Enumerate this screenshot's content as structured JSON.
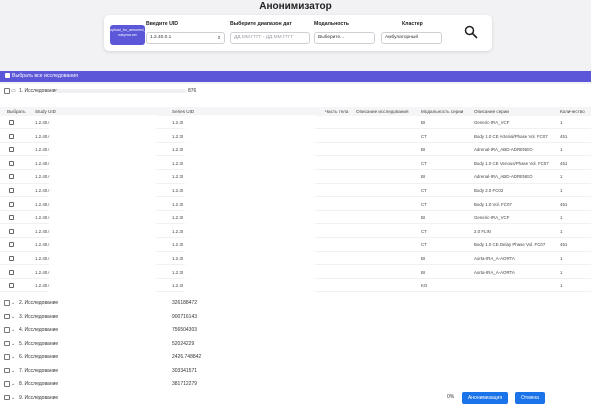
{
  "page_title": "Анонимизатор",
  "toolbar": {
    "upload_label": "upload_for_annonimi_z nakyma.cer",
    "uid_label": "Введите UID",
    "uid_value": "1.2.40.0.1",
    "date_label": "Выберите диапазон дат",
    "date_placeholder": "ДД.ММ.ГГГГ - ДД.ММ.ГГГГ",
    "modality_label": "Модальность",
    "modality_value": "Выберите...",
    "cluster_label": "Кластер",
    "cluster_value": "Амбулаторный"
  },
  "select_all_label": "Выбрать все исследования",
  "expanded_study": {
    "label": "1. Исследование",
    "number": "876"
  },
  "table_headers": {
    "select": "Выбрать",
    "study_uid": "Study UID",
    "series_uid": "Series UID",
    "body_part": "Часть тела",
    "study_desc": "Описание исследования",
    "modality": "Модальность серии",
    "series_desc": "Описание серии",
    "count": "Количество"
  },
  "series_rows": [
    {
      "study_uid": "1.2.40.0",
      "series_uid": "1.2.3t",
      "modality": "BI",
      "desc": "Generic-IRA_VCF",
      "count": "1"
    },
    {
      "study_uid": "1.2.40.0",
      "series_uid": "1.2.3t",
      "modality": "CT",
      "desc": "Body 1.0 CE Arterial/Phase Vol. FC07",
      "count": "451"
    },
    {
      "study_uid": "1.2.40.0",
      "series_uid": "1.2.3t",
      "modality": "BI",
      "desc": "Adrenal-IRA_ABD-ADRENEO",
      "count": "1"
    },
    {
      "study_uid": "1.2.40.0",
      "series_uid": "1.2.3t",
      "modality": "CT",
      "desc": "Body 1.0 CE Venous/Phase Vol. FC07",
      "count": "451"
    },
    {
      "study_uid": "1.2.40.0",
      "series_uid": "1.2.3t",
      "modality": "BI",
      "desc": "Adrenal-IRA_ABD-ADRENEO",
      "count": "1"
    },
    {
      "study_uid": "1.2.40.0",
      "series_uid": "1.2.3t",
      "modality": "CT",
      "desc": "Body 2.0 FC02",
      "count": "1"
    },
    {
      "study_uid": "1.2.40.0",
      "series_uid": "1.2.3t",
      "modality": "CT",
      "desc": "Body 1.0 Vol. FC07",
      "count": "451"
    },
    {
      "study_uid": "1.2.40.0",
      "series_uid": "1.2.3t",
      "modality": "BI",
      "desc": "Generic-IRA_VCF",
      "count": "1"
    },
    {
      "study_uid": "1.2.40.0",
      "series_uid": "1.2.3t",
      "modality": "CT",
      "desc": "2.0 FLIN",
      "count": "1"
    },
    {
      "study_uid": "1.2.40.0",
      "series_uid": "1.2.3t",
      "modality": "CT",
      "desc": "Body 1.0 CE Delay Phase Vol. FC07",
      "count": "451"
    },
    {
      "study_uid": "1.2.40.0",
      "series_uid": "1.2.3t",
      "modality": "BI",
      "desc": "Aorta-IRA_A-AORTA",
      "count": "1"
    },
    {
      "study_uid": "1.2.40.0",
      "series_uid": "1.2.3t",
      "modality": "BI",
      "desc": "Aorta-IRA_A-AORTA",
      "count": "1"
    },
    {
      "study_uid": "1.2.40.0",
      "series_uid": "1.2.4t",
      "modality": "KO",
      "desc": "",
      "count": "1"
    }
  ],
  "studies": [
    {
      "label": "2. Исследование",
      "number": "326188472"
    },
    {
      "label": "3. Исследование",
      "number": "900716143"
    },
    {
      "label": "4. Исследование",
      "number": "756504303"
    },
    {
      "label": "5. Исследование",
      "number": "52024229"
    },
    {
      "label": "6. Исследование",
      "number": "2426.748842"
    },
    {
      "label": "7. Исследование",
      "number": "303341571"
    },
    {
      "label": "8. Исследование",
      "number": "381712279"
    },
    {
      "label": "9. Исследование",
      "number": ""
    }
  ],
  "footer": {
    "progress": "0%",
    "anonymize_label": "Анонимизация",
    "cancel_label": "Отмена"
  },
  "colors": {
    "accent": "#5b57d8",
    "button_blue": "#1a73e8"
  }
}
